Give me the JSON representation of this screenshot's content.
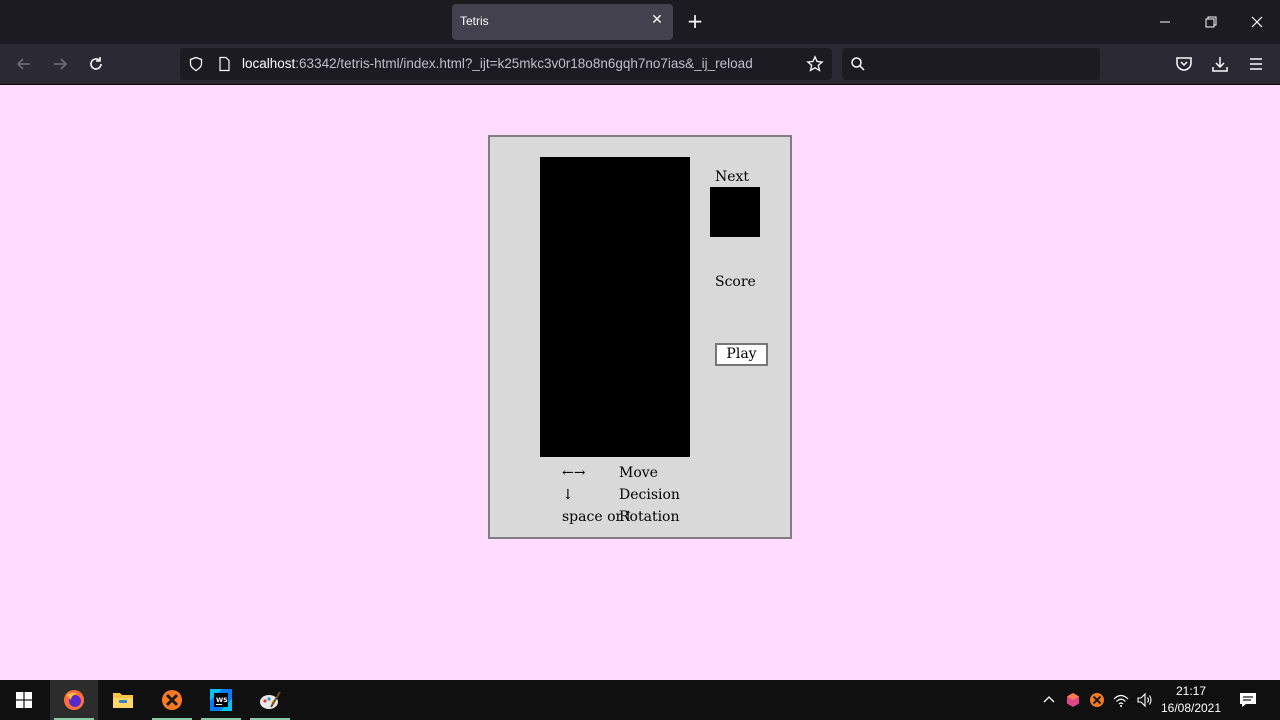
{
  "browser": {
    "tab_title": "Tetris",
    "url_host": "localhost",
    "url_rest": ":63342/tetris-html/index.html?_ijt=k25mkc3v0r18o8n6gqh7no7ias&_ij_reload",
    "colors": {
      "chrome_dark": "#1c1b22",
      "chrome_mid": "#2b2a33",
      "tab_active": "#42414d"
    }
  },
  "page": {
    "background": "#ffdcff",
    "next_label": "Next",
    "score_label": "Score",
    "score_value": "",
    "play_label": "Play",
    "controls": [
      {
        "key": "←→",
        "action": "Move"
      },
      {
        "key": "↓",
        "action": "Decision"
      },
      {
        "key": "space or↑",
        "action": "Rotation"
      }
    ]
  },
  "taskbar": {
    "time": "21:17",
    "date": "16/08/2021",
    "apps": [
      "windows-start-icon",
      "firefox-icon",
      "file-explorer-icon",
      "xampp-icon",
      "webstorm-icon",
      "paint-app-icon"
    ]
  }
}
